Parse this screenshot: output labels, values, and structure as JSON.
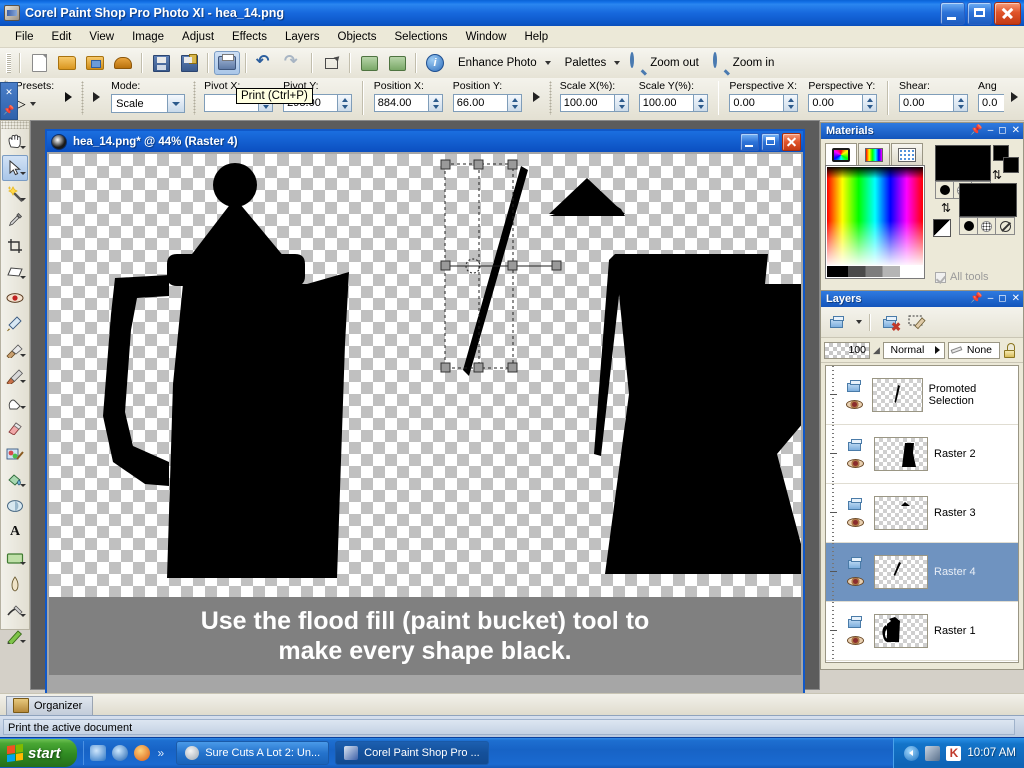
{
  "window": {
    "title": "Corel Paint Shop Pro Photo XI - hea_14.png",
    "icon": "app-icon",
    "minimize": "Minimize",
    "maximize": "Maximize",
    "close": "Close"
  },
  "menubar": {
    "items": [
      {
        "label": "File",
        "accel": "F"
      },
      {
        "label": "Edit",
        "accel": "E"
      },
      {
        "label": "View",
        "accel": "V"
      },
      {
        "label": "Image",
        "accel": "I"
      },
      {
        "label": "Adjust",
        "accel": "A"
      },
      {
        "label": "Effects",
        "accel": "c"
      },
      {
        "label": "Layers",
        "accel": "L"
      },
      {
        "label": "Objects",
        "accel": "O"
      },
      {
        "label": "Selections",
        "accel": "S"
      },
      {
        "label": "Window",
        "accel": "W"
      },
      {
        "label": "Help",
        "accel": "H"
      }
    ]
  },
  "toolbar": {
    "buttons": [
      {
        "name": "new-icon",
        "tip": "New"
      },
      {
        "name": "open-icon",
        "tip": "Open"
      },
      {
        "name": "browse-icon",
        "tip": "Browse"
      },
      {
        "name": "scanner-icon",
        "tip": "Import from scanner"
      },
      {
        "name": "save-icon",
        "tip": "Save"
      },
      {
        "name": "save-as-icon",
        "tip": "Save As"
      },
      {
        "name": "print-icon",
        "tip": "Print"
      },
      {
        "name": "undo-icon",
        "tip": "Undo"
      },
      {
        "name": "redo-icon",
        "tip": "Redo"
      },
      {
        "name": "crop-icon",
        "tip": "Crop"
      },
      {
        "name": "rotate-left-icon",
        "tip": "Rotate Left"
      },
      {
        "name": "rotate-right-icon",
        "tip": "Rotate Right"
      },
      {
        "name": "info-icon",
        "tip": "Image Information"
      }
    ],
    "enhance_photo": "Enhance Photo",
    "palettes": "Palettes",
    "zoom_out": "Zoom out",
    "zoom_in": "Zoom in"
  },
  "tooltip": {
    "text": "Print (Ctrl+P)"
  },
  "options_bar": {
    "presets_label": "Presets:",
    "mode_label": "Mode:",
    "mode_value": "Scale",
    "pivot_x_label": "Pivot X:",
    "pivot_x_value": "",
    "pivot_y_label": "Pivot Y:",
    "pivot_y_value": "295.00",
    "position_x_label": "Position X:",
    "position_x_value": "884.00",
    "position_y_label": "Position Y:",
    "position_y_value": "66.00",
    "scale_x_label": "Scale X(%):",
    "scale_x_value": "100.00",
    "scale_y_label": "Scale Y(%):",
    "scale_y_value": "100.00",
    "perspective_x_label": "Perspective X:",
    "perspective_x_value": "0.00",
    "perspective_y_label": "Perspective Y:",
    "perspective_y_value": "0.00",
    "shear_label": "Shear:",
    "shear_value": "0.00",
    "angle_label": "Ang",
    "angle_value": "0.0"
  },
  "toolbox": {
    "tools": [
      {
        "name": "pan-tool",
        "label": "Pan",
        "selected": false,
        "dropdown": true
      },
      {
        "name": "pick-tool",
        "label": "Pick",
        "selected": true,
        "dropdown": true
      },
      {
        "name": "magic-wand-tool",
        "label": "Magic Wand",
        "selected": false,
        "dropdown": true
      },
      {
        "name": "dropper-tool",
        "label": "Dropper",
        "selected": false,
        "dropdown": false
      },
      {
        "name": "crop-tool",
        "label": "Crop",
        "selected": false,
        "dropdown": false
      },
      {
        "name": "straighten-tool",
        "label": "Straighten",
        "selected": false,
        "dropdown": true
      },
      {
        "name": "red-eye-tool",
        "label": "Red Eye",
        "selected": false,
        "dropdown": false
      },
      {
        "name": "makeover-tool",
        "label": "Makeover",
        "selected": false,
        "dropdown": false
      },
      {
        "name": "clone-brush-tool",
        "label": "Clone Brush",
        "selected": false,
        "dropdown": true
      },
      {
        "name": "paint-brush-tool",
        "label": "Paint Brush",
        "selected": false,
        "dropdown": true
      },
      {
        "name": "smudge-tool",
        "label": "Smudge",
        "selected": false,
        "dropdown": true
      },
      {
        "name": "eraser-tool",
        "label": "Eraser",
        "selected": false,
        "dropdown": false
      },
      {
        "name": "picture-tube-tool",
        "label": "Picture Tube",
        "selected": false,
        "dropdown": false
      },
      {
        "name": "flood-fill-tool",
        "label": "Flood Fill",
        "selected": false,
        "dropdown": true
      },
      {
        "name": "color-changer-tool",
        "label": "Color Changer",
        "selected": false,
        "dropdown": false
      },
      {
        "name": "text-tool",
        "label": "Text",
        "selected": false,
        "dropdown": false
      },
      {
        "name": "preset-shape-tool",
        "label": "Preset Shape",
        "selected": false,
        "dropdown": true
      },
      {
        "name": "pen-tool",
        "label": "Pen",
        "selected": false,
        "dropdown": false
      },
      {
        "name": "warp-brush-tool",
        "label": "Warp Brush",
        "selected": false,
        "dropdown": true
      },
      {
        "name": "mesh-warp-tool",
        "label": "Mesh Warp",
        "selected": false,
        "dropdown": true
      }
    ]
  },
  "document": {
    "title": "hea_14.png* @  44% (Raster 4)",
    "zoom": "44%",
    "active_layer": "Raster 4",
    "caption_line1": "Use the flood fill (paint bucket) tool to",
    "caption_line2": "make every shape black."
  },
  "materials": {
    "title": "Materials",
    "tabs": [
      {
        "name": "frame-tab",
        "label": "Frame"
      },
      {
        "name": "rainbow-tab",
        "label": "Rainbow"
      },
      {
        "name": "swatches-tab",
        "label": "Swatches"
      }
    ],
    "all_tools_label": "All tools",
    "foreground_color": "#000000",
    "background_color": "#000000"
  },
  "layers": {
    "title": "Layers",
    "opacity": "100",
    "blend_mode": "Normal",
    "mask_label": "None",
    "items": [
      {
        "name": "Promoted Selection",
        "selected": false,
        "visible": true
      },
      {
        "name": "Raster 2",
        "selected": false,
        "visible": true
      },
      {
        "name": "Raster 3",
        "selected": false,
        "visible": true
      },
      {
        "name": "Raster 4",
        "selected": true,
        "visible": true
      },
      {
        "name": "Raster 1",
        "selected": false,
        "visible": true
      }
    ]
  },
  "organizer": {
    "label": "Organizer"
  },
  "statusbar": {
    "message": "Print the active document"
  },
  "taskbar": {
    "start_label": "start",
    "quick_launch": [
      "show-desktop-icon",
      "media-player-icon",
      "firefox-icon"
    ],
    "more_chevron": "»",
    "tasks": [
      {
        "label": "Sure Cuts A Lot 2: Un...",
        "icon": "scal-icon",
        "active": false
      },
      {
        "label": "Corel Paint Shop Pro ...",
        "icon": "psp-icon",
        "active": true
      }
    ],
    "tray_icons": [
      "show-hidden-icon",
      "network-icon",
      "antivirus-icon"
    ],
    "clock": "10:07 AM"
  }
}
